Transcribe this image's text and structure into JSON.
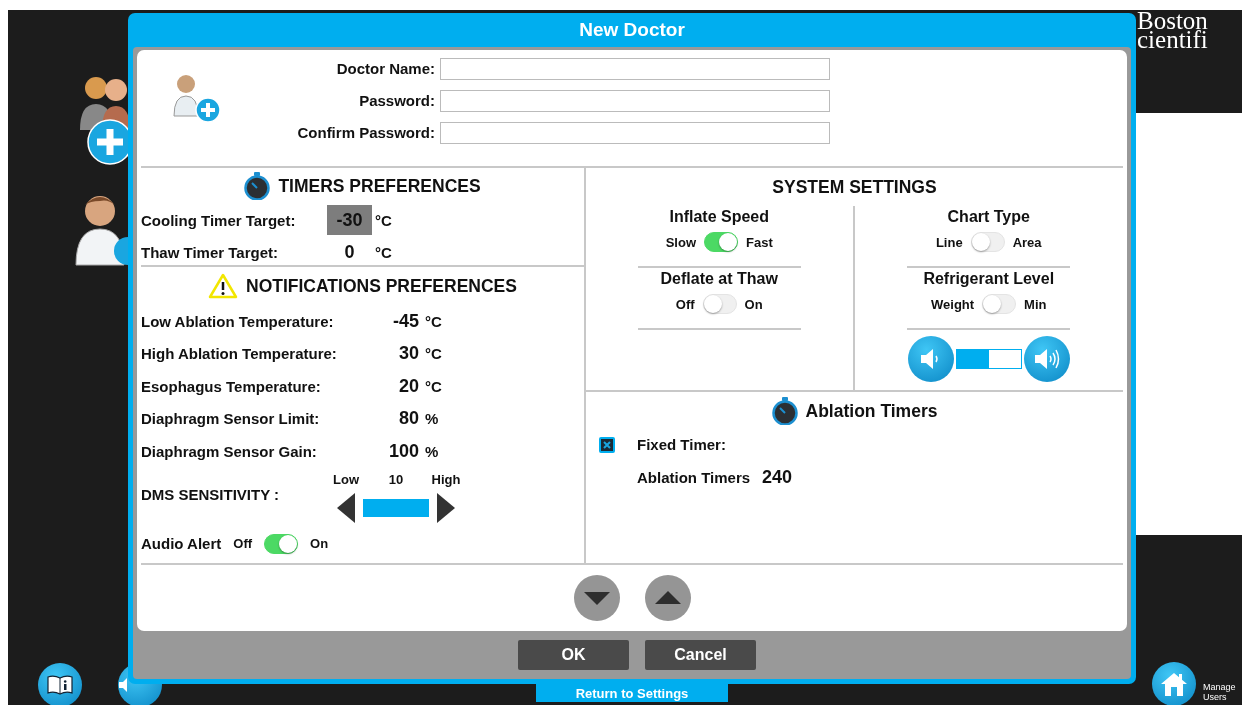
{
  "background": {
    "logo_lines": [
      "Boston",
      "cientifi"
    ],
    "manage_users": "Manage Users",
    "return_button": "Return to Settings"
  },
  "dialog": {
    "title": "New Doctor",
    "fields": [
      {
        "label": "Doctor Name:"
      },
      {
        "label": "Password:"
      },
      {
        "label": "Confirm Password:"
      }
    ],
    "timers": {
      "title": "TIMERS PREFERENCES",
      "rows": [
        {
          "label": "Cooling Timer Target:",
          "value": "-30",
          "unit": "°C",
          "selected": true
        },
        {
          "label": "Thaw Timer Target:",
          "value": "0",
          "unit": "°C",
          "selected": false
        }
      ]
    },
    "notifications": {
      "title": "NOTIFICATIONS PREFERENCES",
      "rows": [
        {
          "label": "Low Ablation Temperature:",
          "value": "-45",
          "unit": "°C"
        },
        {
          "label": "High Ablation Temperature:",
          "value": "30",
          "unit": "°C"
        },
        {
          "label": "Esophagus Temperature:",
          "value": "20",
          "unit": "°C"
        },
        {
          "label": "Diaphragm Sensor Limit:",
          "value": "80",
          "unit": "%"
        },
        {
          "label": "Diaphragm Sensor Gain:",
          "value": "100",
          "unit": "%"
        }
      ],
      "dms": {
        "label": "DMS SENSITIVITY :",
        "low": "Low",
        "value": "10",
        "high": "High"
      },
      "audio_alert": {
        "label": "Audio Alert",
        "off_label": "Off",
        "on_label": "On",
        "on": true
      }
    },
    "system": {
      "title": "SYSTEM SETTINGS",
      "toggles": [
        {
          "title": "Inflate Speed",
          "left": "Slow",
          "right": "Fast",
          "on": true
        },
        {
          "title": "Chart Type",
          "left": "Line",
          "right": "Area",
          "on": false
        },
        {
          "title": "Deflate at Thaw",
          "left": "Off",
          "right": "On",
          "on": false
        },
        {
          "title": "Refrigerant Level",
          "left": "Weight",
          "right": "Min",
          "on": false
        }
      ],
      "volume": {
        "level": 0.5
      }
    },
    "ablation": {
      "title": "Ablation Timers",
      "fixed_timer": {
        "label": "Fixed Timer:",
        "checked": true
      },
      "timer_label": "Ablation Timers",
      "timer_value": "240"
    },
    "buttons": [
      "OK",
      "Cancel"
    ]
  }
}
